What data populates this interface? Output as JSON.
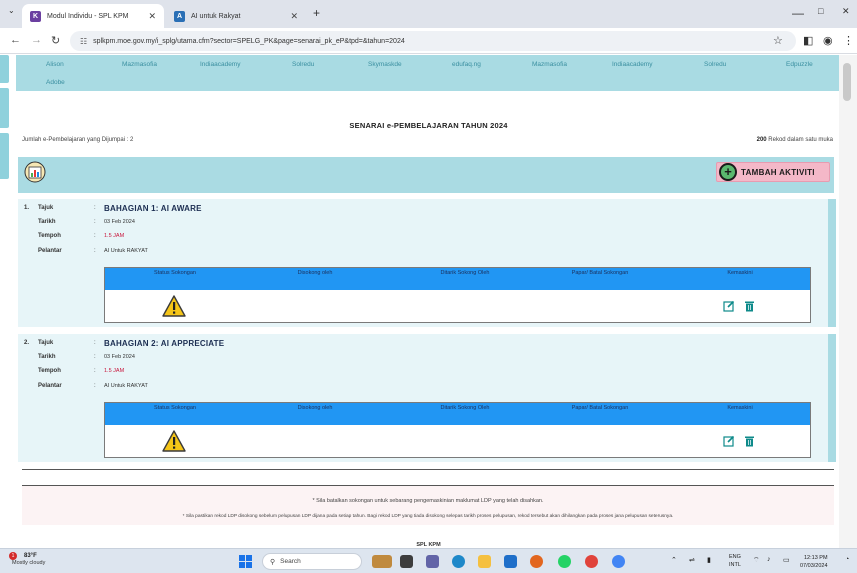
{
  "browser": {
    "tabs": [
      {
        "title": "Modul Individu - SPL KPM",
        "favicon": "splkpm-logo-icon"
      },
      {
        "title": "AI untuk Rakyat",
        "favicon": "ai-rakyat-icon"
      }
    ],
    "new_tab_label": "+",
    "url": "splkpm.moe.gov.my/i_splg/utama.cfm?sector=SPELG_PK&page=senarai_pk_eP&tpd=&tahun=2024",
    "window_controls": [
      "—",
      "□",
      "✕"
    ]
  },
  "topnav": {
    "links": [
      "Alison",
      "Mazmasofia",
      "Indiaacademy",
      "Solredu",
      "Skymaskde",
      "edufaq.ng",
      "Mazmasofia",
      "Indiaacademy",
      "Solredu",
      "Edpuzzle",
      "Adobe"
    ]
  },
  "page": {
    "title": "SENARAI e-PEMBELAJARAN TAHUN 2024",
    "count_label": "Jumlah e-Pembelajaran yang Dijumpai : 2",
    "per_page_number": "200",
    "per_page_text": "Rekod dalam satu muka",
    "add_button_label": "TAMBAH AKTIVITI"
  },
  "field_labels": {
    "tajuk": "Tajuk",
    "tarikh": "Tarikh",
    "tempoh": "Tempoh",
    "pelantar": "Pelantar",
    "colon": ":"
  },
  "table_headers": {
    "status": "Status Sokongan",
    "disokong": "Disokong oleh",
    "ditarik": "Ditarik Sokong Oleh",
    "papar": "Papar/ Batal Sokongan",
    "kemaskini": "Kemaskini"
  },
  "activities": [
    {
      "index": "1.",
      "title": "BAHAGIAN 1: AI AWARE",
      "date": "03 Feb 2024",
      "duration": "1.5 JAM",
      "platform": "AI Untuk RAKYAT"
    },
    {
      "index": "2.",
      "title": "BAHAGIAN 2: AI APPRECIATE",
      "date": "03 Feb 2024",
      "duration": "1.5 JAM",
      "platform": "AI Untuk RAKYAT"
    }
  ],
  "notes": {
    "note1": "* Sila batalkan sokongan untuk sebarang pengemaskinian maklumat LDP yang telah disahkan.",
    "note2": "* Sila pastikan rekod LDP disokong sebelum pelupusan LDP dijana pada setiap tahun. Bagi rekod LDP yang tiada disokong selepas tarikh proses pelupusan, rekod tersebut akan dihilangkan pada proses jana pelupusan seterusnya."
  },
  "footer": "SPL KPM",
  "taskbar": {
    "badge": "1",
    "temperature": "83°F",
    "weather_condition": "Mostly cloudy",
    "search_label": "Search",
    "language_top": "ENG",
    "language_bottom": "INTL",
    "time": "12:13 PM",
    "date": "07/03/2024"
  },
  "colors": {
    "nav_bg": "#a9dbe3",
    "table_header": "#2196f3",
    "add_button": "#f4b8c8",
    "duration_red": "#c8143a"
  }
}
